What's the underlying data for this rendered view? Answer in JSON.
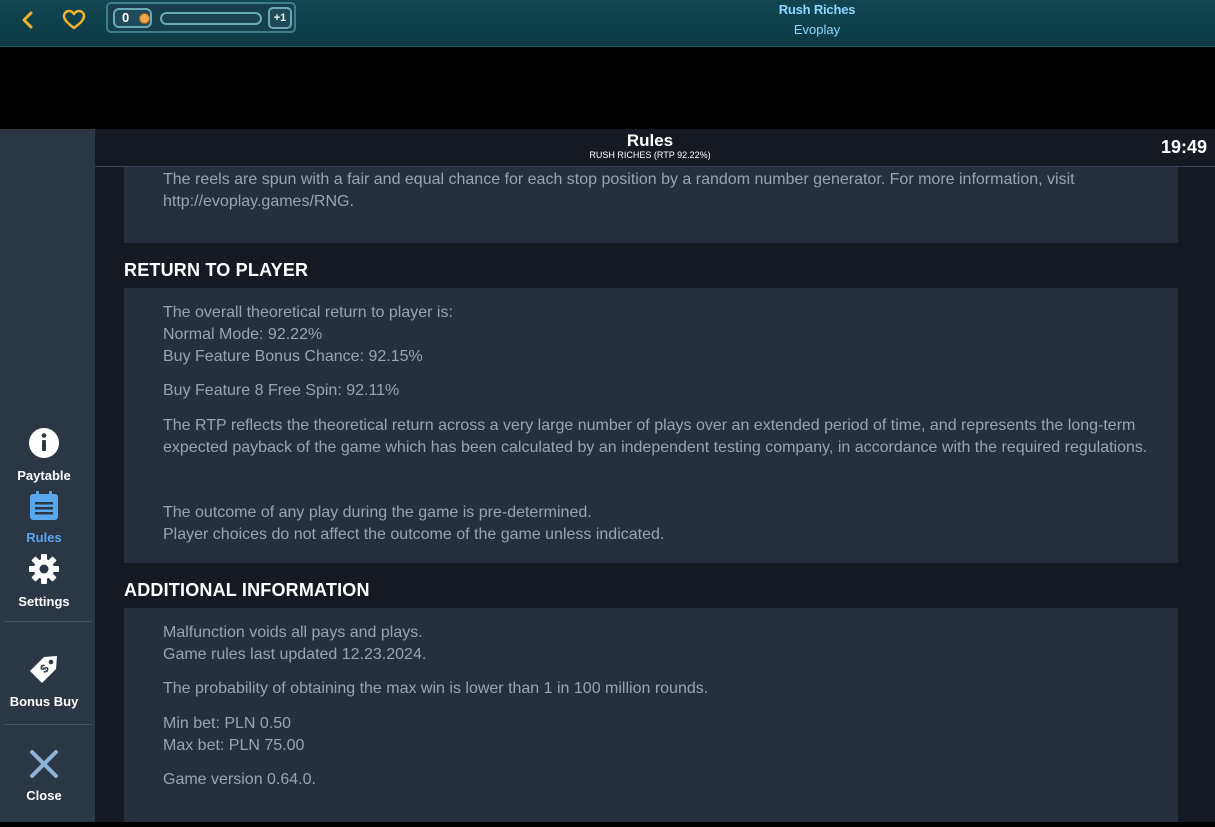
{
  "topbar": {
    "coins": "0",
    "plus_label": "+1",
    "progress": 0,
    "game_title": "Rush Riches",
    "provider": "Evoplay",
    "accent_color": "#8fd8ff"
  },
  "header": {
    "title": "Rules",
    "subtitle": "RUSH RICHES (RTP 92.22%)",
    "clock": "19:49"
  },
  "sidebar": {
    "items": [
      {
        "label": "Paytable",
        "icon": "info-icon"
      },
      {
        "label": "Rules",
        "icon": "rules-list-icon",
        "active": true
      },
      {
        "label": "Settings",
        "icon": "gear-icon"
      },
      {
        "label": "Bonus Buy",
        "icon": "price-tag-icon"
      },
      {
        "label": "Close",
        "icon": "close-icon"
      }
    ],
    "active_color": "#59a7ee"
  },
  "content": {
    "rng_card": {
      "text": "The reels are spun with a fair and equal chance for each stop position by a random number generator. For more information, visit http://evoplay.games/RNG."
    },
    "rtp_heading": "RETURN TO PLAYER",
    "rtp_card": {
      "line1": "The overall theoretical return to player is:",
      "line2": "Normal Mode: 92.22%",
      "line3": "Buy Feature Bonus Chance: 92.15%",
      "line4": "Buy Feature 8 Free Spin: 92.11%",
      "line5": "The RTP reflects the theoretical return across a very large number of plays over an extended period of time, and represents the long-term expected payback of the game which has been calculated by an independent testing company, in accordance with the required regulations.",
      "line6": "The outcome of any play during the game is pre-determined.",
      "line7": "Player choices do not affect the outcome of the game unless indicated."
    },
    "additional_heading": "ADDITIONAL INFORMATION",
    "additional_card": {
      "line1": "Malfunction voids all pays and plays.",
      "line2": "Game rules last updated 12.23.2024.",
      "line3": "The probability of obtaining the max win is lower than 1 in 100 million rounds.",
      "line4": "Min bet: PLN 0.50",
      "line5": "Max bet: PLN 75.00",
      "line6": "Game version 0.64.0."
    }
  }
}
